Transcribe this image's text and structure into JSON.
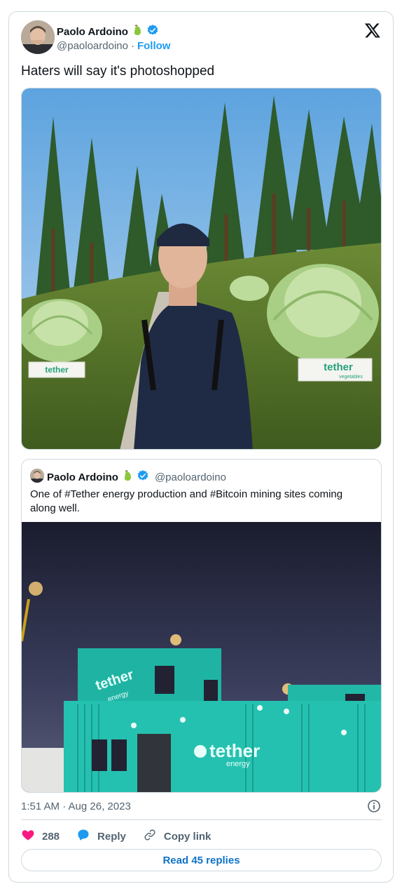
{
  "author": {
    "name": "Paolo Ardoino",
    "handle": "@paoloardoino",
    "separator": "·",
    "follow_label": "Follow",
    "verified_color": "#1d9bf0"
  },
  "icons": {
    "logo": "x-logo-icon",
    "emoji": "pear-emoji-icon",
    "verified": "verified-badge-icon",
    "info": "info-icon",
    "like": "heart-icon",
    "reply": "reply-bubble-icon",
    "copy": "link-icon"
  },
  "tweet": {
    "text": "Haters will say it's photoshopped",
    "timestamp": "1:51 AM · Aug 26, 2023"
  },
  "main_photo": {
    "left_sign": "tether",
    "right_sign": "tether",
    "right_sign_sub": "vegetables"
  },
  "quote": {
    "name": "Paolo Ardoino",
    "handle": "@paoloardoino",
    "text": "One of #Tether energy production and #Bitcoin  mining  sites coming along well.",
    "container_text_1": "tether",
    "container_text_1_sub": "energy",
    "container_text_2": "tether",
    "container_text_2_sub": "energy"
  },
  "actions": {
    "like_count": "288",
    "reply_label": "Reply",
    "copy_label": "Copy link",
    "like_color": "#f91880",
    "reply_color": "#1d9bf0"
  },
  "read_replies_label": "Read 45 replies"
}
